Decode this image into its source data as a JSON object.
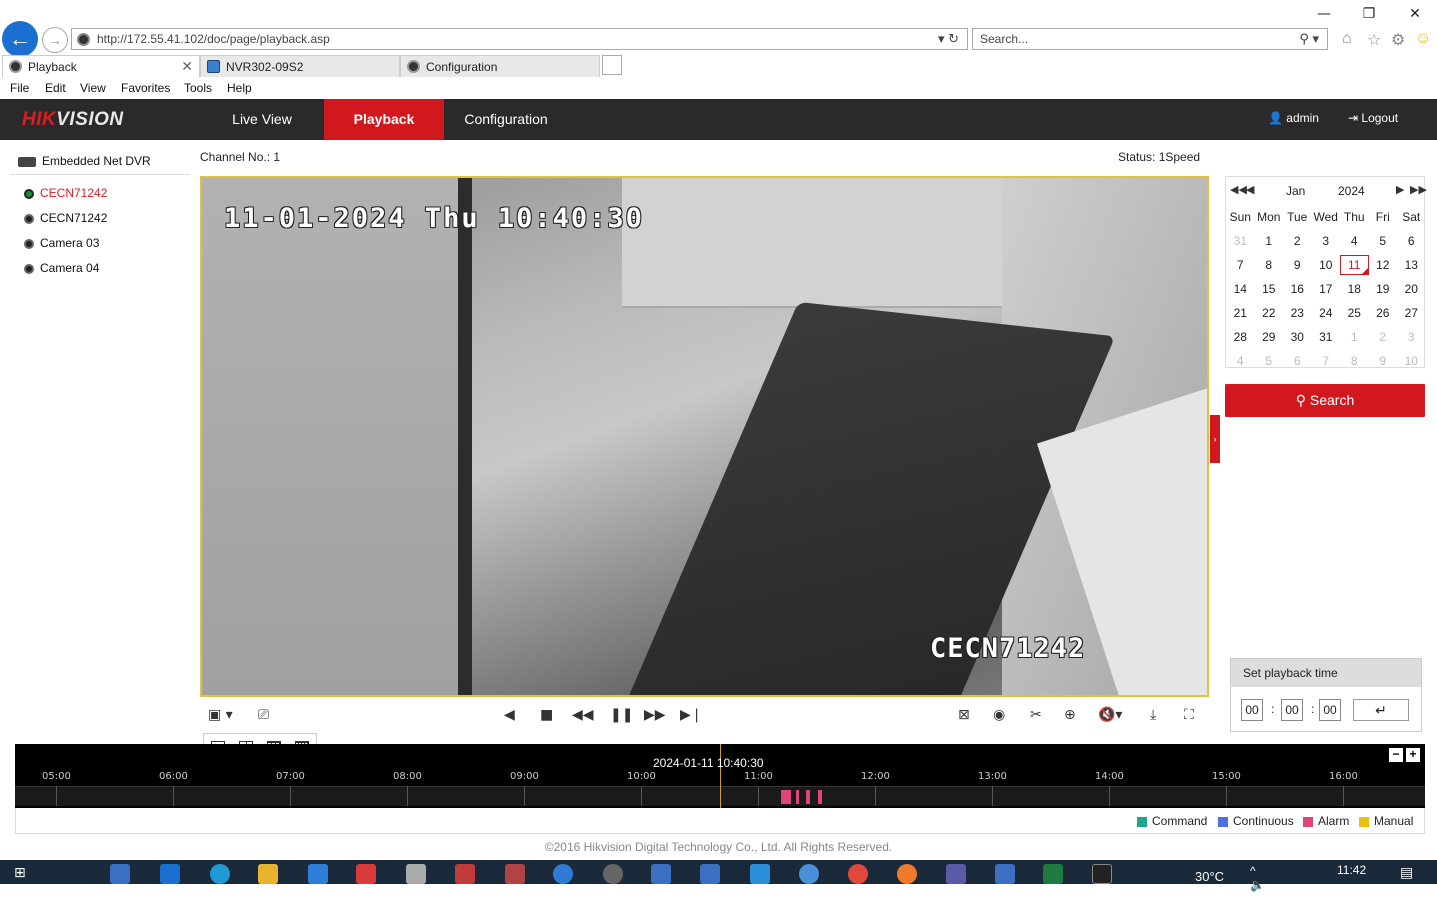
{
  "browser": {
    "address": "http://172.55.41.102/doc/page/playback.asp",
    "search_placeholder": "Search...",
    "tabs": [
      {
        "label": "Playback"
      },
      {
        "label": "NVR302-09S2"
      },
      {
        "label": "Configuration"
      }
    ],
    "menu": [
      "File",
      "Edit",
      "View",
      "Favorites",
      "Tools",
      "Help"
    ]
  },
  "app": {
    "logo_hik": "HIK",
    "logo_vision": "VISION",
    "nav": [
      "Live View",
      "Playback",
      "Configuration"
    ],
    "user": "admin",
    "logout": "Logout"
  },
  "tree": {
    "root": "Embedded Net DVR",
    "cameras": [
      "CECN71242",
      "CECN71242",
      "Camera 03",
      "Camera 04"
    ]
  },
  "player": {
    "channel_label": "Channel No.: 1",
    "status_label": "Status: 1Speed",
    "osd_time": "11-01-2024 Thu 10:40:30",
    "osd_name": "CECN71242"
  },
  "calendar": {
    "month": "Jan",
    "year": "2024",
    "weekdays": [
      "Sun",
      "Mon",
      "Tue",
      "Wed",
      "Thu",
      "Fri",
      "Sat"
    ],
    "weeks": [
      [
        "31",
        "1",
        "2",
        "3",
        "4",
        "5",
        "6"
      ],
      [
        "7",
        "8",
        "9",
        "10",
        "11",
        "12",
        "13"
      ],
      [
        "14",
        "15",
        "16",
        "17",
        "18",
        "19",
        "20"
      ],
      [
        "21",
        "22",
        "23",
        "24",
        "25",
        "26",
        "27"
      ],
      [
        "28",
        "29",
        "30",
        "31",
        "1",
        "2",
        "3"
      ],
      [
        "4",
        "5",
        "6",
        "7",
        "8",
        "9",
        "10"
      ]
    ],
    "selected": "11",
    "search_label": "Search"
  },
  "playback_time": {
    "title": "Set playback time",
    "hh": "00",
    "mm": "00",
    "ss": "00"
  },
  "timeline": {
    "current": "2024-01-11 10:40:30",
    "hours": [
      "05:00",
      "06:00",
      "07:00",
      "08:00",
      "09:00",
      "10:00",
      "11:00",
      "12:00",
      "13:00",
      "14:00",
      "15:00",
      "16:00"
    ]
  },
  "legend": [
    {
      "label": "Command",
      "color": "#1fa58c"
    },
    {
      "label": "Continuous",
      "color": "#4f6fe0"
    },
    {
      "label": "Alarm",
      "color": "#e0457a"
    },
    {
      "label": "Manual",
      "color": "#e8c20f"
    }
  ],
  "footer": "©2016 Hikvision Digital Technology Co., Ltd. All Rights Reserved.",
  "taskbar": {
    "temperature": "30°C",
    "time": "11:42"
  }
}
